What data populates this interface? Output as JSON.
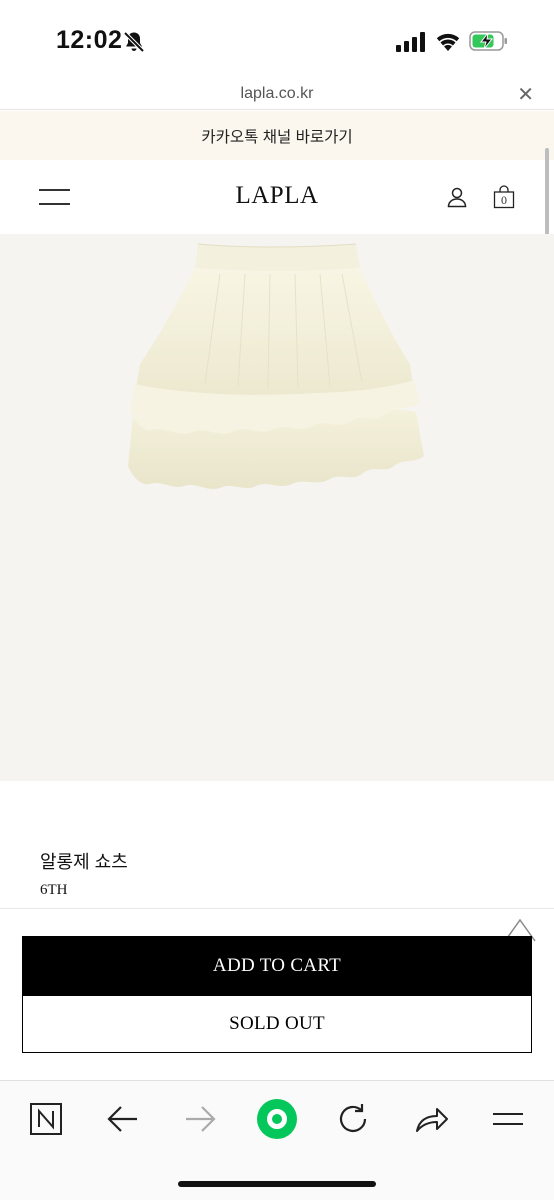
{
  "status_bar": {
    "time": "12:02",
    "icons": [
      "bell-slash-icon",
      "cellular-signal-icon",
      "wifi-icon",
      "battery-charging-icon"
    ]
  },
  "url_bar": {
    "url": "lapla.co.kr",
    "close_label": "✕"
  },
  "banner": {
    "text": "카카오톡 채널 바로가기"
  },
  "header": {
    "logo": "LAPLA",
    "cart_count": "0",
    "icons": [
      "menu-icon",
      "user-icon",
      "shopping-bag-icon"
    ]
  },
  "product": {
    "image_icon": "ruffled-skirt-image",
    "name": "알롱제 쇼츠",
    "subtitle": "6TH"
  },
  "actions": {
    "add_to_cart": "ADD TO CART",
    "sold_out": "SOLD OUT"
  },
  "browser_toolbar": {
    "icons": [
      "naver-n-icon",
      "back-arrow-icon",
      "forward-arrow-icon",
      "green-circle-icon",
      "reload-icon",
      "share-icon",
      "menu-lines-icon"
    ],
    "accent_color": "#03c75a"
  },
  "colors": {
    "banner_bg": "#fbf7ef",
    "image_bg": "#f6f4f1",
    "button_primary": "#000000"
  }
}
